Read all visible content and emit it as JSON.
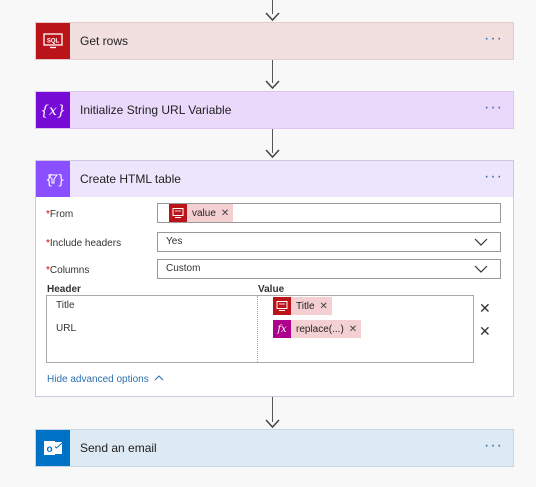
{
  "cards": {
    "get_rows": {
      "title": "Get rows",
      "icon": "sql-icon",
      "color": "#ba141a",
      "bg": "#f2dfe0"
    },
    "init_var": {
      "title": "Initialize String URL Variable",
      "icon": "variable-icon",
      "color": "#770bd6",
      "bg": "#ead9fb"
    },
    "create_table": {
      "title": "Create HTML table",
      "icon": "table-filter-icon",
      "color": "#8a4fff",
      "bg": "#ede5fb"
    },
    "send_email": {
      "title": "Send an email",
      "icon": "outlook-icon",
      "color": "#0072c6",
      "bg": "#dde9f3"
    }
  },
  "menu_glyph": "···",
  "create_table_form": {
    "from": {
      "label": "From",
      "required_mark": "*",
      "token": "value",
      "token_icon": "table-icon",
      "token_color": "#ba141a"
    },
    "include_headers": {
      "label": "Include headers",
      "required_mark": "*",
      "value": "Yes"
    },
    "columns": {
      "label": "Columns",
      "required_mark": "*",
      "value": "Custom"
    },
    "table": {
      "header_label": "Header",
      "value_label": "Value",
      "rows": [
        {
          "header": "Title",
          "value_token": "Title",
          "value_icon": "table-icon",
          "token_color": "#ba141a"
        },
        {
          "header": "URL",
          "value_token": "replace(...)",
          "value_icon": "fx-icon",
          "token_color": "#ad008c"
        }
      ]
    },
    "advanced_link": "Hide advanced options"
  }
}
